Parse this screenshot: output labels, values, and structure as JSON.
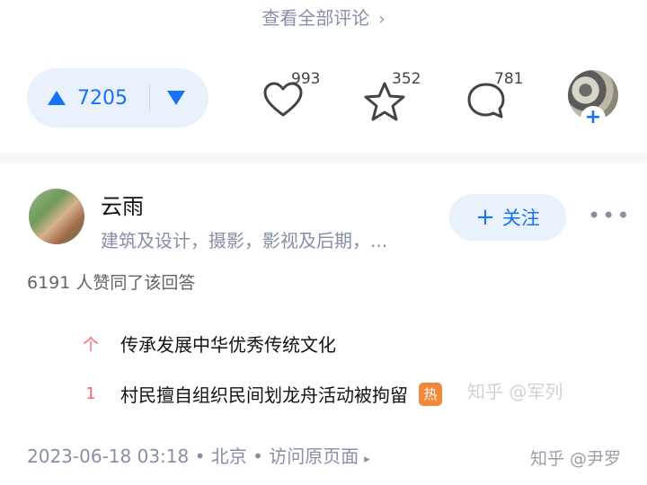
{
  "top": {
    "view_all_comments": "查看全部评论",
    "chevron": "›"
  },
  "actions": {
    "vote_count": "7205",
    "like_count": "993",
    "favorite_count": "352",
    "comment_count": "781",
    "accent": "#1772f6"
  },
  "author": {
    "name": "云雨",
    "bio": "建筑及设计，摄影，影视及后期，...",
    "follow_label": "关注",
    "follow_plus": "+"
  },
  "answer": {
    "agree_text": "6191 人赞同了该回答"
  },
  "hot_list": [
    {
      "rank": "个",
      "title": "传承发展中华优秀传统文化"
    },
    {
      "rank": "1",
      "title": "村民擅自组织民间划龙舟活动被拘留",
      "badge": "热"
    }
  ],
  "meta": {
    "date": "2023-06-18 03:18",
    "location": "北京",
    "dot": "•",
    "source_link": "访问原页面",
    "triangle": "▸"
  },
  "watermarks": {
    "middle": "知乎 @军列",
    "bottom": "知乎 @尹罗"
  }
}
